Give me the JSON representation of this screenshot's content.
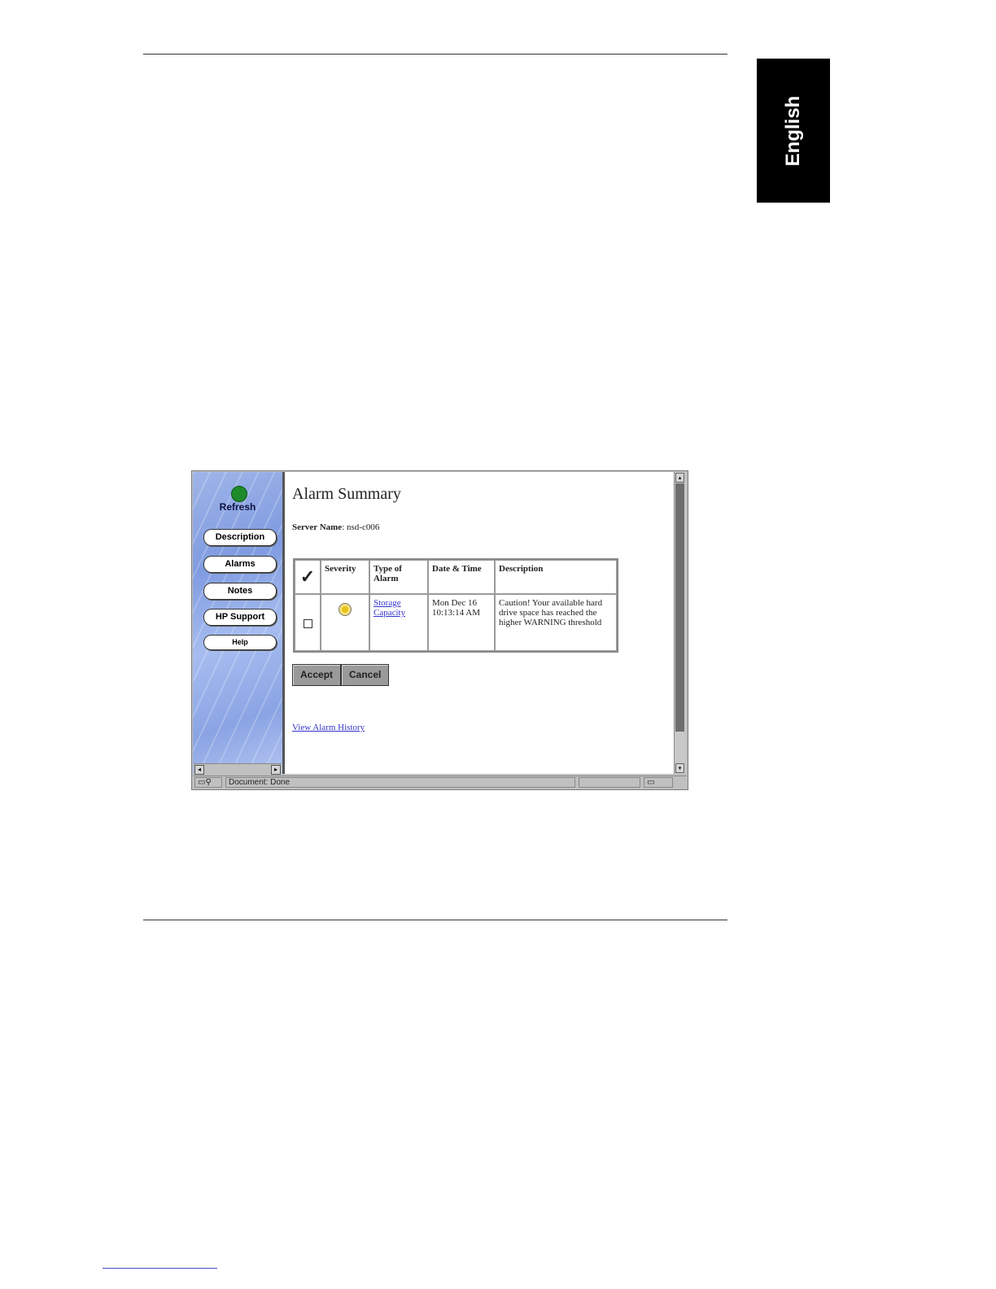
{
  "language_tab": "English",
  "app": {
    "sidebar": {
      "refresh_label": "Refresh",
      "nav": [
        "Description",
        "Alarms",
        "Notes",
        "HP Support",
        "Help"
      ]
    },
    "main": {
      "title": "Alarm Summary",
      "server_label": "Server Name",
      "server_value": "nsd-c006",
      "table": {
        "headers": [
          "✓",
          "Severity",
          "Type of Alarm",
          "Date & Time",
          "Description"
        ],
        "rows": [
          {
            "checked": false,
            "severity_color": "#e8c21a",
            "type": "Storage Capacity",
            "datetime": "Mon Dec 16 10:13:14 AM",
            "description": "Caution! Your available hard drive space has reached the higher WARNING threshold"
          }
        ]
      },
      "buttons": {
        "accept": "Accept",
        "cancel": "Cancel"
      },
      "history_link": "View Alarm History"
    },
    "statusbar": {
      "text": "Document: Done"
    }
  }
}
